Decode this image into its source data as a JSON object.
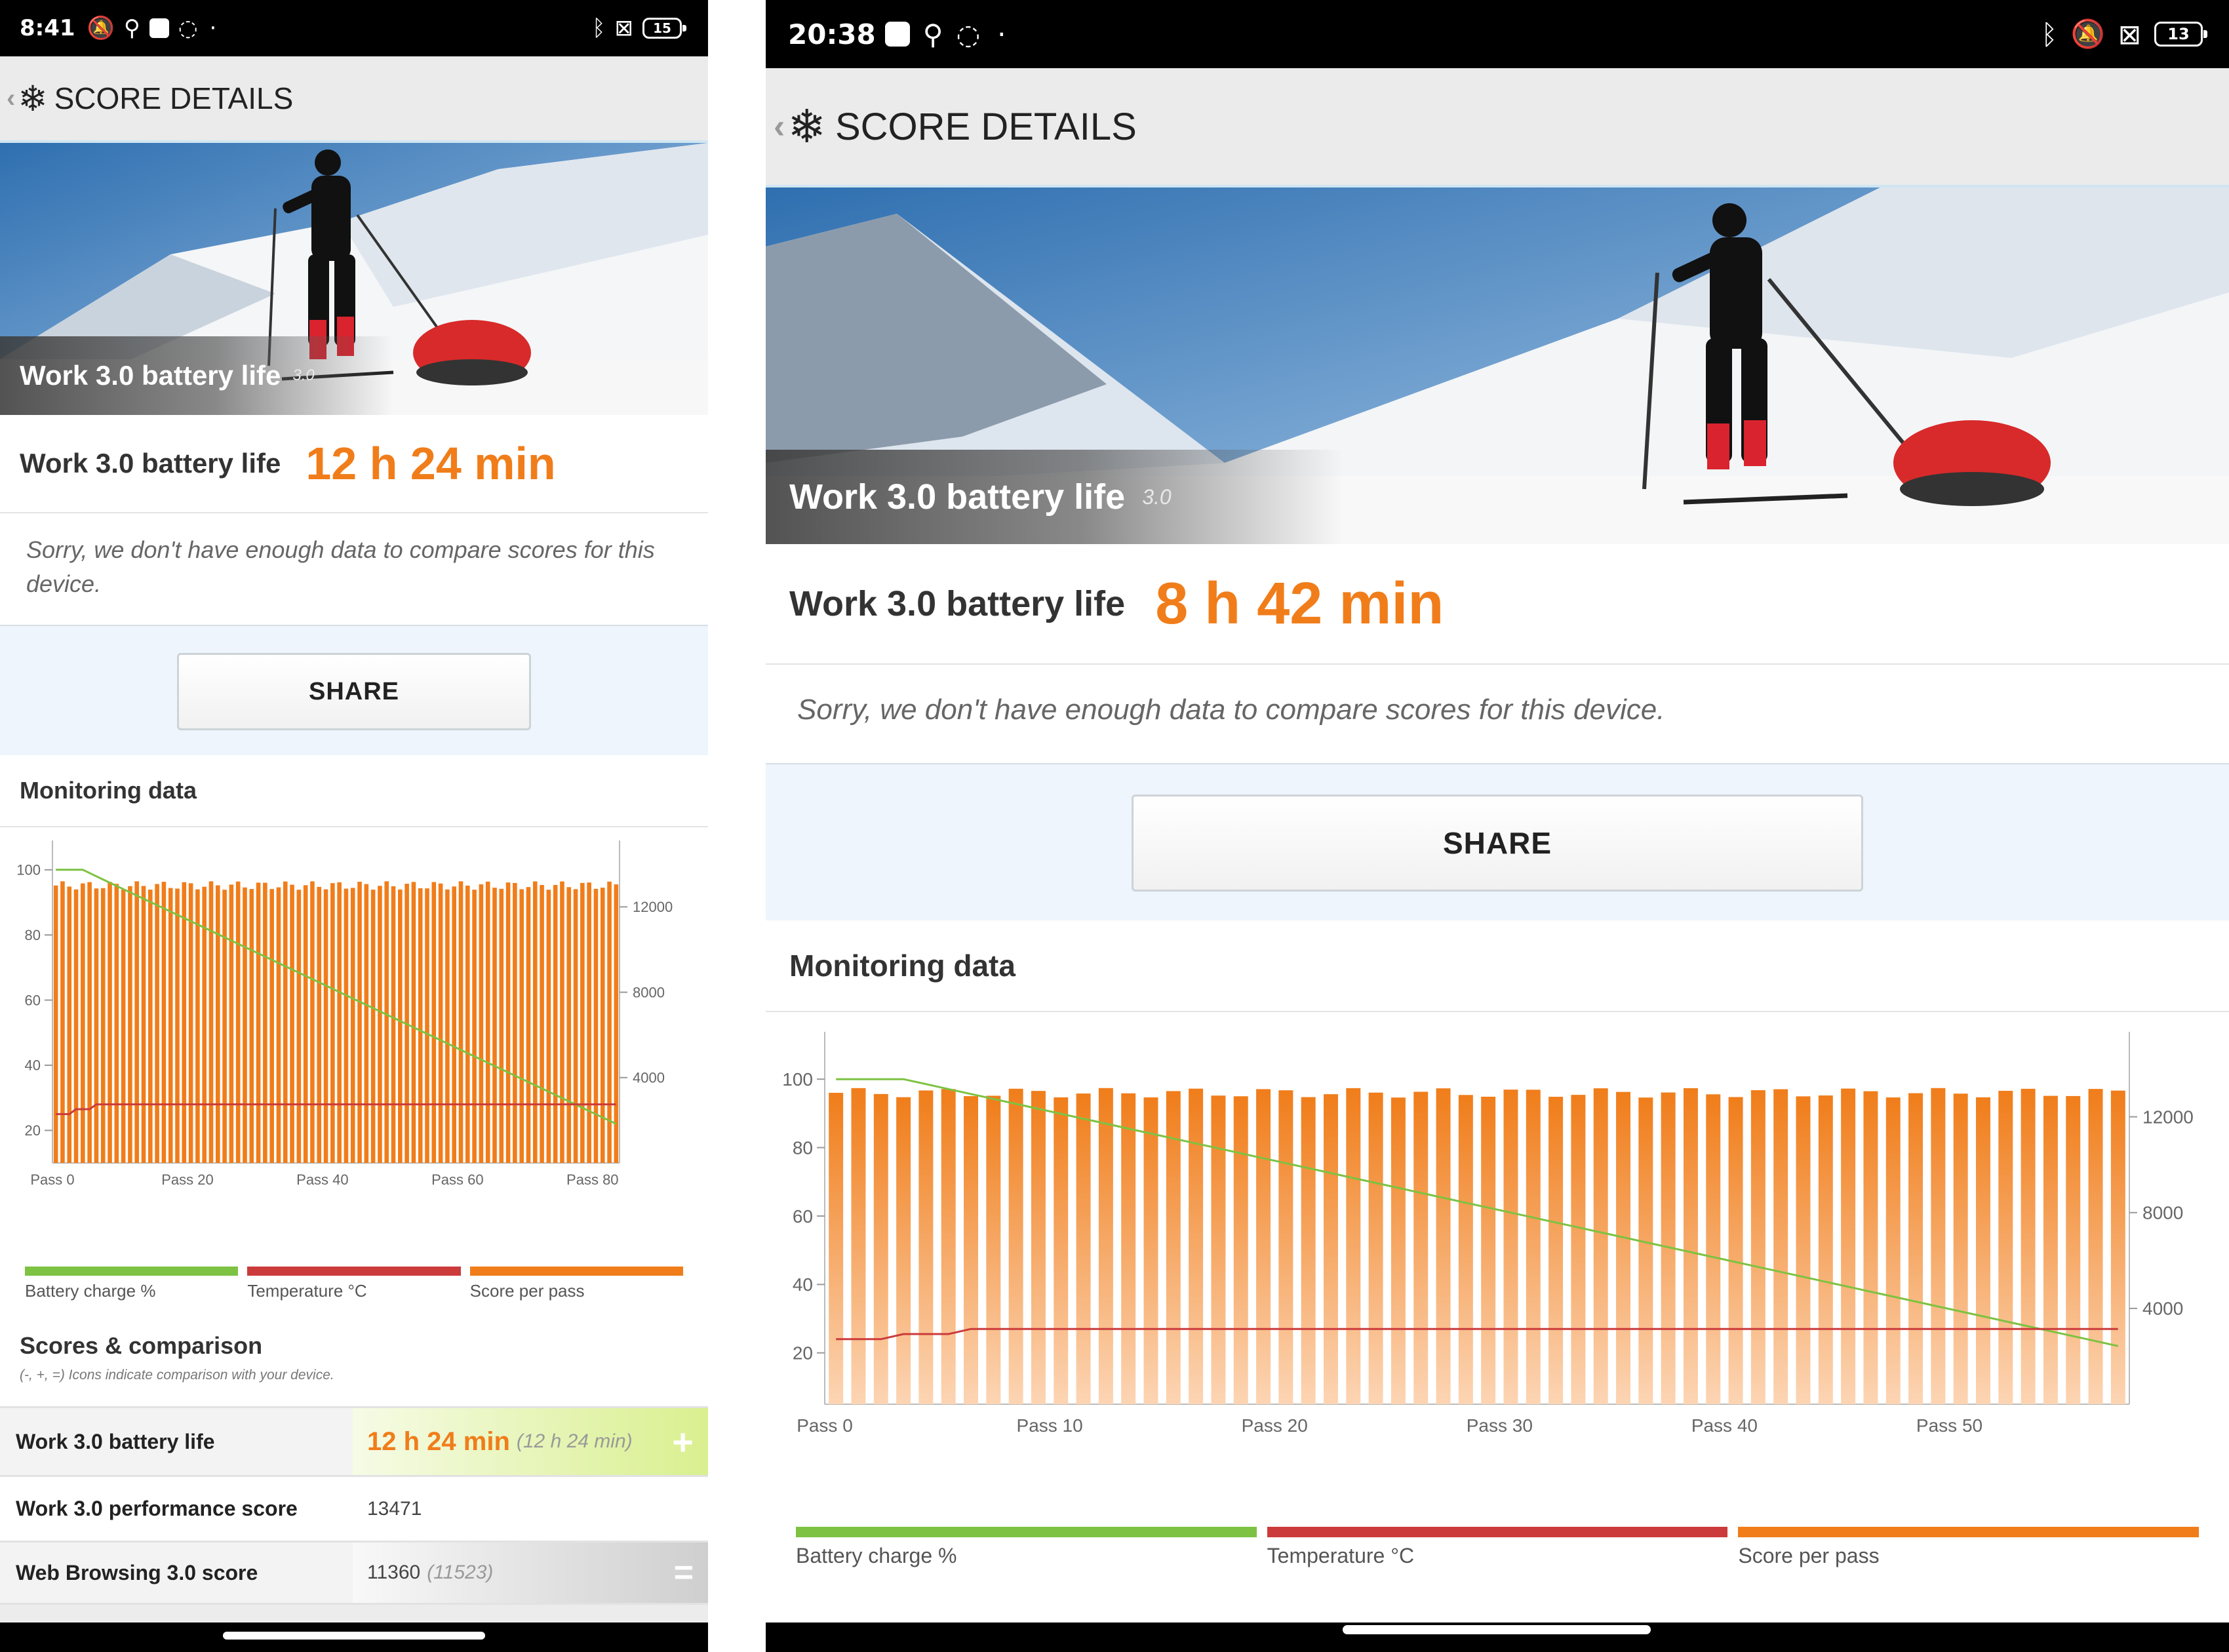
{
  "left": {
    "status": {
      "time": "8:41",
      "battery": "15"
    },
    "appbar": {
      "title": "SCORE DETAILS"
    },
    "hero": {
      "name": "Work 3.0 battery life",
      "version": "3.0"
    },
    "result": {
      "label": "Work 3.0 battery life",
      "value": "12 h 24 min"
    },
    "compare_note": "Sorry, we don't have enough data to compare scores for this device.",
    "share_label": "SHARE",
    "monitoring": {
      "title": "Monitoring data",
      "legend": [
        "Battery charge %",
        "Temperature °C",
        "Score per pass"
      ]
    },
    "scores": {
      "title": "Scores & comparison",
      "note": "(-, +, =) Icons indicate comparison with your device.",
      "rows": [
        {
          "label": "Work 3.0 battery life",
          "value": "12 h 24 min",
          "compare": "(12 h 24 min)",
          "icon": "plus-icon"
        },
        {
          "label": "Work 3.0 performance score",
          "value": "13471",
          "compare": "",
          "icon": ""
        },
        {
          "label": "Web Browsing 3.0 score",
          "value": "11360",
          "compare": "(11523)",
          "icon": "equals-icon"
        }
      ]
    }
  },
  "right": {
    "status": {
      "time": "20:38",
      "battery": "13"
    },
    "appbar": {
      "title": "SCORE DETAILS"
    },
    "hero": {
      "name": "Work 3.0 battery life",
      "version": "3.0"
    },
    "result": {
      "label": "Work 3.0 battery life",
      "value": "8 h 42 min"
    },
    "compare_note": "Sorry, we don't have enough data to compare scores for this device.",
    "share_label": "SHARE",
    "monitoring": {
      "title": "Monitoring data",
      "legend": [
        "Battery charge %",
        "Temperature °C",
        "Score per pass"
      ]
    }
  },
  "colors": {
    "accent": "#f07d1a",
    "battery": "#7dc242",
    "temperature": "#cc3b3b",
    "score": "#f07d1a"
  },
  "chart_data": [
    {
      "type": "bar",
      "name": "left-monitoring",
      "x_ticks": [
        "Pass 0",
        "Pass 20",
        "Pass 40",
        "Pass 60",
        "Pass 80"
      ],
      "y_left_ticks": [
        20,
        40,
        60,
        80,
        100
      ],
      "y_right_ticks": [
        4000,
        8000,
        12000
      ],
      "passes": 84,
      "series": [
        {
          "name": "Battery charge %",
          "axis": "left",
          "start": 100,
          "end": 22,
          "flat_passes": 4
        },
        {
          "name": "Temperature °C",
          "axis": "left",
          "start": 25,
          "end": 28
        },
        {
          "name": "Score per pass",
          "axis": "right",
          "typical": 13200
        }
      ],
      "ylim_left": [
        10,
        105
      ],
      "ylim_right": [
        0,
        14500
      ]
    },
    {
      "type": "bar",
      "name": "right-monitoring",
      "x_ticks": [
        "Pass 0",
        "Pass 10",
        "Pass 20",
        "Pass 30",
        "Pass 40",
        "Pass 50"
      ],
      "y_left_ticks": [
        20,
        40,
        60,
        80,
        100
      ],
      "y_right_ticks": [
        4000,
        8000,
        12000
      ],
      "passes": 58,
      "series": [
        {
          "name": "Battery charge %",
          "axis": "left",
          "start": 100,
          "end": 22,
          "flat_passes": 3
        },
        {
          "name": "Temperature °C",
          "axis": "left",
          "start": 24,
          "end": 27
        },
        {
          "name": "Score per pass",
          "axis": "right",
          "typical": 13200
        }
      ],
      "ylim_left": [
        5,
        110
      ],
      "ylim_right": [
        0,
        15000
      ]
    }
  ]
}
